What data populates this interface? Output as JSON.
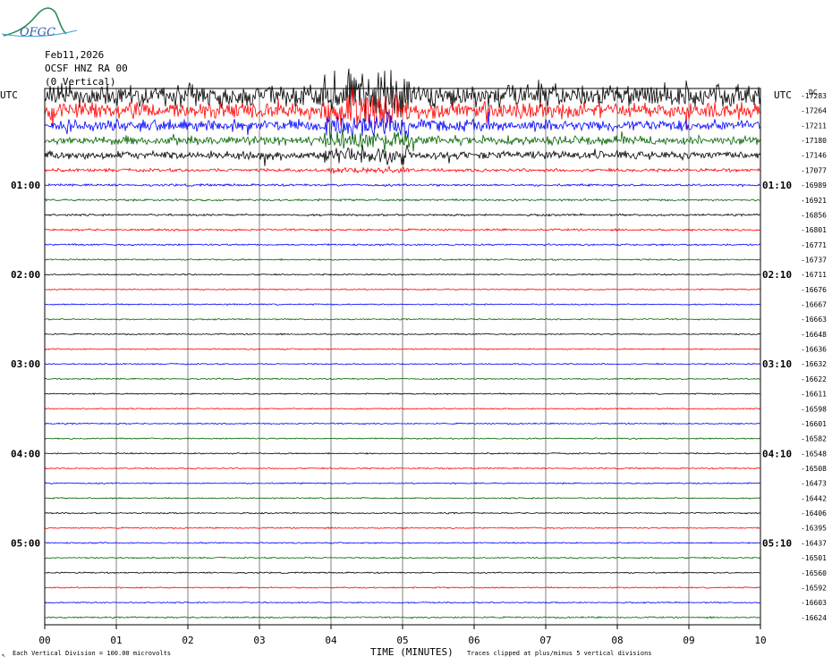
{
  "logo_text": "OFGC",
  "header": {
    "date": "Feb11,2026",
    "station": "OCSF HNZ RA 00",
    "component": "(0 Vertical)"
  },
  "utc_left": "UTC",
  "utc_right": "UTC",
  "top_right_label": "DC",
  "footer": {
    "left": "Each Vertical Division =  100.00 microvolts",
    "center": "TIME (MINUTES)",
    "right": "Traces clipped at plus/minus 5 vertical divisions",
    "corner_mark": "↖"
  },
  "colors": {
    "trace_cycle": [
      "#000000",
      "#ff0000",
      "#0000ff",
      "#006400"
    ],
    "grid": "#808080",
    "frame": "#000000"
  },
  "chart_data": {
    "type": "line",
    "title": "OCSF HNZ RA 00 (0 Vertical) Feb11,2026",
    "xlabel": "TIME (MINUTES)",
    "ylabel": "",
    "xlim": [
      0,
      10
    ],
    "x_ticks": [
      "00",
      "01",
      "02",
      "03",
      "04",
      "05",
      "06",
      "07",
      "08",
      "09",
      "10"
    ],
    "vertical_division_microvolts": 100.0,
    "clip_divisions": 5,
    "left_time_labels": [
      "01:00",
      "02:00",
      "03:00",
      "04:00",
      "05:00"
    ],
    "right_time_labels": [
      "01:10",
      "02:10",
      "03:10",
      "04:10",
      "05:10"
    ],
    "trace_offsets": [
      -17283,
      -17264,
      -17211,
      -17180,
      -17146,
      -17077,
      -16989,
      -16921,
      -16856,
      -16801,
      -16771,
      -16737,
      -16711,
      -16676,
      -16667,
      -16663,
      -16648,
      -16636,
      -16632,
      -16622,
      -16611,
      -16598,
      -16601,
      -16582,
      -16548,
      -16508,
      -16473,
      -16442,
      -16406,
      -16395,
      -16437,
      -16501,
      -16560,
      -16592,
      -16603,
      -16624
    ],
    "trace_amplitude_level": [
      5,
      3.5,
      2.5,
      2,
      1.8,
      0.7,
      0.5,
      0.45,
      0.45,
      0.45,
      0.4,
      0.35,
      0.3,
      0.3,
      0.3,
      0.3,
      0.3,
      0.3,
      0.3,
      0.3,
      0.3,
      0.3,
      0.3,
      0.3,
      0.3,
      0.3,
      0.3,
      0.3,
      0.3,
      0.3,
      0.3,
      0.3,
      0.3,
      0.3,
      0.3,
      0.35
    ],
    "event_window_minutes": [
      3.9,
      5.1
    ],
    "grid": true
  }
}
